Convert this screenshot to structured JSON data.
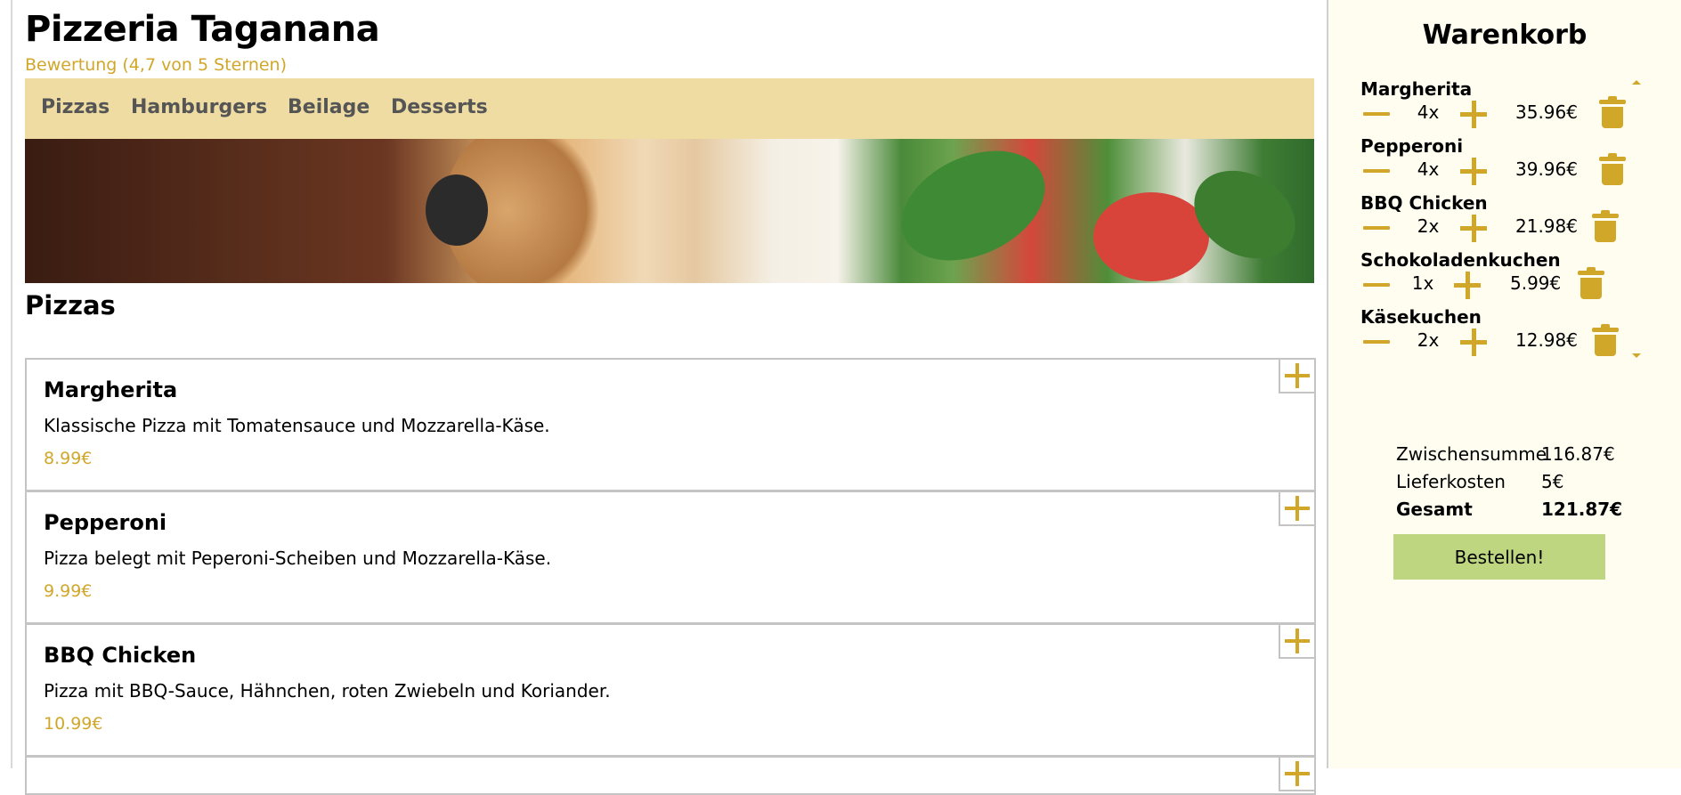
{
  "header": {
    "title": "Pizzeria Taganana",
    "rating": "Bewertung (4,7 von 5 Sternen)"
  },
  "nav": {
    "items": [
      "Pizzas",
      "Hamburgers",
      "Beilage",
      "Desserts"
    ]
  },
  "section": {
    "title": "Pizzas"
  },
  "menu": [
    {
      "name": "Margherita",
      "description": "Klassische Pizza mit Tomatensauce und Mozzarella-Käse.",
      "price": "8.99€"
    },
    {
      "name": "Pepperoni",
      "description": "Pizza belegt mit Peperoni-Scheiben und Mozzarella-Käse.",
      "price": "9.99€"
    },
    {
      "name": "BBQ Chicken",
      "description": "Pizza mit BBQ-Sauce, Hähnchen, roten Zwiebeln und Koriander.",
      "price": "10.99€"
    }
  ],
  "cart": {
    "title": "Warenkorb",
    "items": [
      {
        "name": "Margherita",
        "qty": "4x",
        "total": "35.96€"
      },
      {
        "name": "Pepperoni",
        "qty": "4x",
        "total": "39.96€"
      },
      {
        "name": "BBQ Chicken",
        "qty": "2x",
        "total": "21.98€"
      },
      {
        "name": "Schokoladenkuchen",
        "qty": "1x",
        "total": "5.99€"
      },
      {
        "name": "Käsekuchen",
        "qty": "2x",
        "total": "12.98€"
      }
    ],
    "subtotal_label": "Zwischensumme",
    "subtotal_value": "116.87€",
    "delivery_label": "Lieferkosten",
    "delivery_value": "5€",
    "total_label": "Gesamt",
    "total_value": "121.87€",
    "order_button": "Bestellen!"
  },
  "colors": {
    "accent": "#d1a72a",
    "nav_bg": "#eedca3",
    "sidebar_bg": "#fefdf0",
    "order_button_bg": "#bfd680"
  },
  "icons": {
    "add": "plus-icon",
    "decrement": "minus-icon",
    "delete": "trash-icon"
  }
}
